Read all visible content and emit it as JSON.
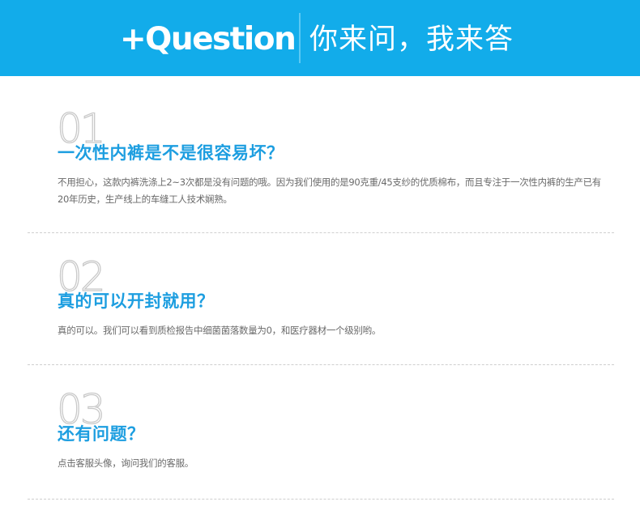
{
  "header": {
    "brand": "+Question",
    "subtitle": "你来问，我来答",
    "background_color": "#12acea"
  },
  "qa_items": [
    {
      "number": "01",
      "question": "一次性内裤是不是很容易坏？",
      "answer": "不用担心，这款内裤洗涤上2~3次都是没有问题的哦。因为我们使用的是90克重/45支纱的优质棉布，而且专注于一次性内裤的生产已有20年历史，生产线上的车缝工人技术娴熟。"
    },
    {
      "number": "02",
      "question": "真的可以开封就用？",
      "answer": "真的可以。我们可以看到质检报告中细菌菌落数量为0，和医疗器材一个级别哟。"
    },
    {
      "number": "03",
      "question": "还有问题？",
      "answer": "点击客服头像，询问我们的客服。"
    }
  ],
  "colors": {
    "question_text": "#1d9ee0",
    "answer_text": "#6a6a6a",
    "number_outline": "#c9c9c9",
    "divider": "#cfcfcf"
  }
}
